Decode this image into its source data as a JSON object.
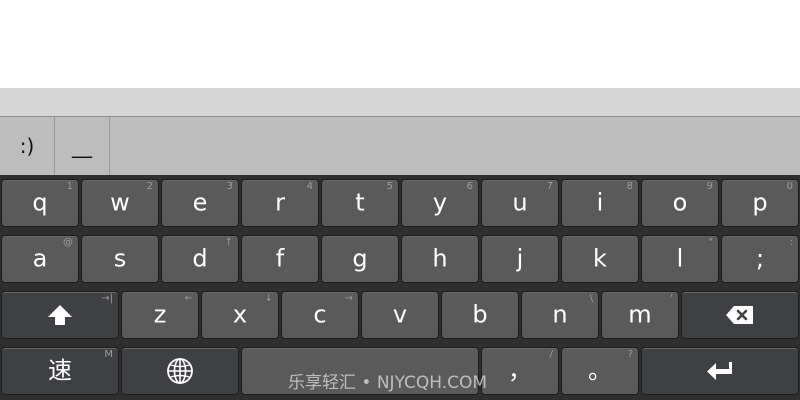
{
  "candidates": [
    ":)",
    "__"
  ],
  "rows": {
    "row1": [
      {
        "label": "q",
        "hint": "1"
      },
      {
        "label": "w",
        "hint": "2"
      },
      {
        "label": "e",
        "hint": "3"
      },
      {
        "label": "r",
        "hint": "4"
      },
      {
        "label": "t",
        "hint": "5"
      },
      {
        "label": "y",
        "hint": "6"
      },
      {
        "label": "u",
        "hint": "7"
      },
      {
        "label": "i",
        "hint": "8"
      },
      {
        "label": "o",
        "hint": "9"
      },
      {
        "label": "p",
        "hint": "0"
      }
    ],
    "row2": [
      {
        "label": "a",
        "hint": "@"
      },
      {
        "label": "s",
        "hint": ""
      },
      {
        "label": "d",
        "hint": "↑"
      },
      {
        "label": "f",
        "hint": ""
      },
      {
        "label": "g",
        "hint": ""
      },
      {
        "label": "h",
        "hint": ""
      },
      {
        "label": "j",
        "hint": ""
      },
      {
        "label": "k",
        "hint": ""
      },
      {
        "label": "l",
        "hint": "\""
      },
      {
        "label": ";",
        "hint": ":"
      }
    ],
    "row3": [
      {
        "label": "",
        "hint": "→|"
      },
      {
        "label": "z",
        "hint": "←"
      },
      {
        "label": "x",
        "hint": "↓"
      },
      {
        "label": "c",
        "hint": "→"
      },
      {
        "label": "v",
        "hint": ""
      },
      {
        "label": "b",
        "hint": ""
      },
      {
        "label": "n",
        "hint": "\\"
      },
      {
        "label": "m",
        "hint": "'"
      }
    ],
    "row4": [
      {
        "label": "速",
        "hint": "M"
      },
      {
        "label": "",
        "hint": ""
      },
      {
        "label": "",
        "hint": ""
      },
      {
        "label": "，",
        "hint": "/"
      },
      {
        "label": "。",
        "hint": "?"
      }
    ]
  },
  "watermark": "乐享轻汇 • NJYCQH.COM",
  "colors": {
    "key": "#5a5a5a",
    "key_dark": "#3e4043",
    "keyboard_bg": "#2f2f2f",
    "candidate_bar": "#bdbdbd"
  },
  "icons": {
    "shift": "shift-arrow-icon",
    "backspace": "backspace-icon",
    "globe": "globe-icon",
    "enter": "enter-icon"
  }
}
